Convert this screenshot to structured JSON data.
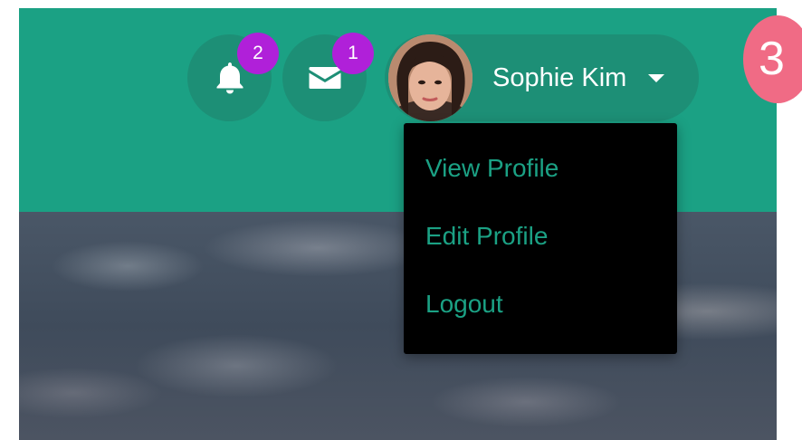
{
  "header": {
    "color": "#1ba184",
    "notifications": {
      "icon": "bell-icon",
      "count": "2"
    },
    "messages": {
      "icon": "envelope-icon",
      "count": "1"
    },
    "user": {
      "name": "Sophie Kim",
      "avatar_icon": "user-avatar"
    }
  },
  "dropdown": {
    "items": [
      {
        "label": "View Profile"
      },
      {
        "label": "Edit Profile"
      },
      {
        "label": "Logout"
      }
    ]
  },
  "step_badge": {
    "label": "3",
    "color": "#f06b85"
  },
  "badge_color": "#b020d9"
}
